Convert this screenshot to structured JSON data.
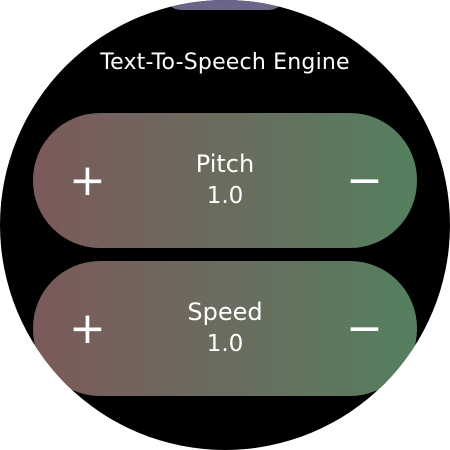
{
  "header": {
    "title": "Text-To-Speech Engine"
  },
  "controls": [
    {
      "label": "Pitch",
      "value": "1.0",
      "increase_symbol": "+",
      "decrease_symbol": "−"
    },
    {
      "label": "Speed",
      "value": "1.0",
      "increase_symbol": "+",
      "decrease_symbol": "−"
    }
  ],
  "colors": {
    "background": "#000000",
    "pill_gradient_start": "#7b5a5a",
    "pill_gradient_end": "#54805e",
    "top_indicator": "#6c6589",
    "text": "#ffffff"
  }
}
